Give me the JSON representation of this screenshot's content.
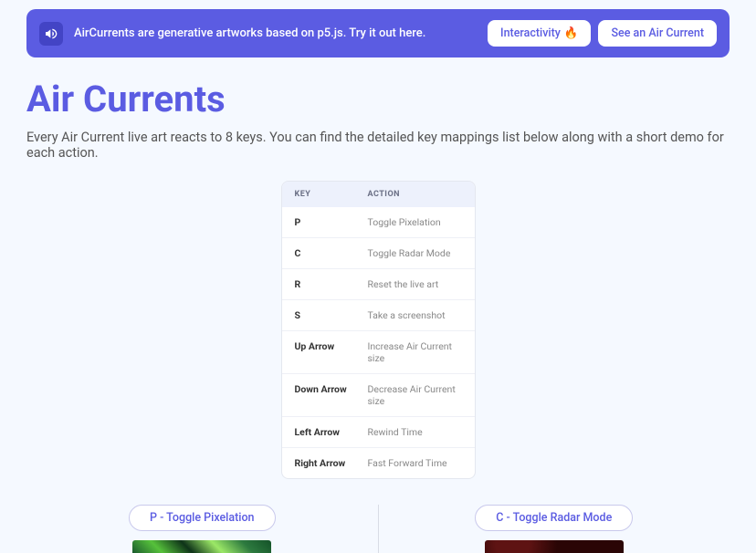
{
  "banner": {
    "text": "AirCurrents are generative artworks based on p5.js. Try it out here.",
    "interactivity_label": "Interactivity",
    "fire": "🔥",
    "see_label": "See an Air Current"
  },
  "title": "Air Currents",
  "subtitle": "Every Air Current live art reacts to 8 keys. You can find the detailed key mappings list below along with a short demo for each action.",
  "table": {
    "head_key": "KEY",
    "head_action": "ACTION",
    "rows": [
      {
        "key": "P",
        "action": "Toggle Pixelation"
      },
      {
        "key": "C",
        "action": "Toggle Radar Mode"
      },
      {
        "key": "R",
        "action": "Reset the live art"
      },
      {
        "key": "S",
        "action": "Take a screenshot"
      },
      {
        "key": "Up Arrow",
        "action": "Increase Air Current size"
      },
      {
        "key": "Down Arrow",
        "action": "Decrease Air Current size"
      },
      {
        "key": "Left Arrow",
        "action": "Rewind Time"
      },
      {
        "key": "Right Arrow",
        "action": "Fast Forward Time"
      }
    ]
  },
  "demo": {
    "pill1": "P - Toggle Pixelation",
    "pill2": "C - Toggle Radar Mode"
  }
}
